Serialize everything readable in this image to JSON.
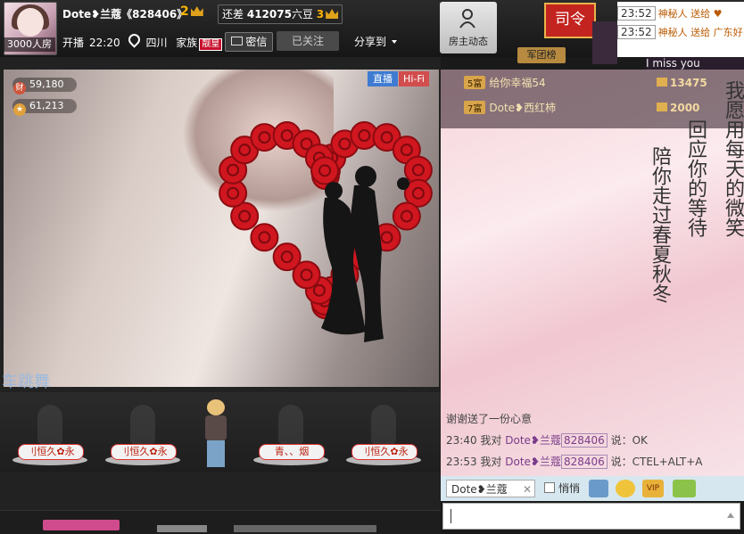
{
  "header": {
    "avatar_caption": "3000人房",
    "host_name": "Dote❥兰蔻《828406》",
    "host_level": "2",
    "gap_label": "还差",
    "gap_value": "412075",
    "gap_unit": "六豆",
    "next_level": "3",
    "start_label": "开播",
    "start_time": "22:20",
    "location": "四川",
    "clan_label": "家族",
    "clan_badge": "靓皇",
    "message_button": "密信",
    "follow_button": "已关注",
    "share_button": "分享到"
  },
  "host_dynamics_button": "房主动态",
  "siling_button": "司令",
  "army_button": "军团榜",
  "notice": {
    "items": [
      {
        "time": "23:52",
        "text": "神秘人 送给 ♥"
      },
      {
        "time": "23:52",
        "text": "神秘人 送给 广东好"
      }
    ],
    "banner_text": "I miss you"
  },
  "stage": {
    "live_badge": "直播",
    "hifi_badge": "Hi-Fi",
    "stat_wealth": "59,180",
    "stat_charm": "61,213",
    "overlay_text": "车跳舞",
    "seats": [
      "刂恒久✿永",
      "刂恒久✿永",
      "青、、烟",
      "刂恒久✿永"
    ]
  },
  "chat": {
    "gift_rows": [
      {
        "level": "5富",
        "text": "给你幸福54"
      },
      {
        "level": "7富",
        "text": "Dote❥西红柿"
      }
    ],
    "coins": [
      "13475",
      "2000"
    ],
    "poem_columns": [
      "我愿用每天的微笑",
      "回应你的等待",
      "陪你走过春夏秋冬"
    ],
    "log": [
      {
        "prefix": "谢谢",
        "user": "",
        "id": "",
        "text": "送了一份心意"
      },
      {
        "prefix": "23:40 我对",
        "user": "Dote❥兰蔻",
        "id": "828406",
        "text": "说：OK"
      },
      {
        "prefix": "23:53 我对",
        "user": "Dote❥兰蔻",
        "id": "828406",
        "text": "说：CTEL+ALT+A"
      }
    ]
  },
  "input_bar": {
    "target_user": "Dote❥兰蔻",
    "whisper_label": "悄悄",
    "vip_label": "VIP"
  },
  "colors": {
    "accent_red": "#c3241f",
    "live_blue": "#3e7bd1",
    "hifi_red": "#d24d4d",
    "toolbar": "#d7e7ef"
  }
}
